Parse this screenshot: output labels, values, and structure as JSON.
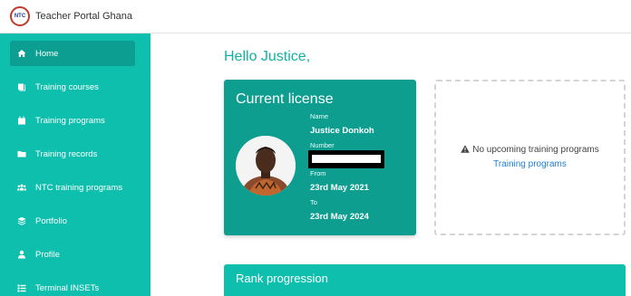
{
  "app": {
    "title": "Teacher Portal Ghana",
    "logo_text": "NTC"
  },
  "sidebar": {
    "items": [
      {
        "label": "Home",
        "icon": "home-icon",
        "active": true
      },
      {
        "label": "Training courses",
        "icon": "book-icon"
      },
      {
        "label": "Training programs",
        "icon": "calendar-icon"
      },
      {
        "label": "Training records",
        "icon": "folder-icon"
      },
      {
        "label": "NTC training programs",
        "icon": "users-icon"
      },
      {
        "label": "Portfolio",
        "icon": "layers-icon"
      },
      {
        "label": "Profile",
        "icon": "user-icon"
      },
      {
        "label": "Terminal INSETs",
        "icon": "list-icon"
      }
    ]
  },
  "main": {
    "greeting": "Hello Justice,",
    "license": {
      "title": "Current license",
      "name_label": "Name",
      "name": "Justice Donkoh",
      "number_label": "Number",
      "from_label": "From",
      "from": "23rd May 2021",
      "to_label": "To",
      "to": "23rd May 2024"
    },
    "upcoming": {
      "message": "No upcoming training programs",
      "link": "Training programs",
      "icon": "warning-icon"
    },
    "rank": {
      "title": "Rank progression"
    }
  },
  "colors": {
    "sidebar": "#0fbfad",
    "card": "#0d9e90",
    "accent": "#0fb3a3",
    "link": "#1f7fd1"
  }
}
